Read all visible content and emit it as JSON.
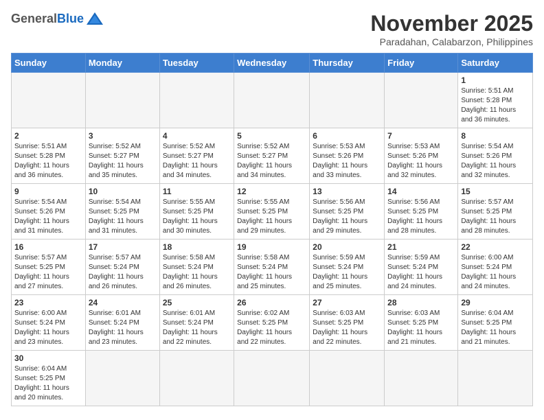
{
  "header": {
    "logo_general": "General",
    "logo_blue": "Blue",
    "month": "November 2025",
    "location": "Paradahan, Calabarzon, Philippines"
  },
  "days_of_week": [
    "Sunday",
    "Monday",
    "Tuesday",
    "Wednesday",
    "Thursday",
    "Friday",
    "Saturday"
  ],
  "weeks": [
    [
      {
        "day": "",
        "info": ""
      },
      {
        "day": "",
        "info": ""
      },
      {
        "day": "",
        "info": ""
      },
      {
        "day": "",
        "info": ""
      },
      {
        "day": "",
        "info": ""
      },
      {
        "day": "",
        "info": ""
      },
      {
        "day": "1",
        "info": "Sunrise: 5:51 AM\nSunset: 5:28 PM\nDaylight: 11 hours\nand 36 minutes."
      }
    ],
    [
      {
        "day": "2",
        "info": "Sunrise: 5:51 AM\nSunset: 5:28 PM\nDaylight: 11 hours\nand 36 minutes."
      },
      {
        "day": "3",
        "info": "Sunrise: 5:52 AM\nSunset: 5:27 PM\nDaylight: 11 hours\nand 35 minutes."
      },
      {
        "day": "4",
        "info": "Sunrise: 5:52 AM\nSunset: 5:27 PM\nDaylight: 11 hours\nand 34 minutes."
      },
      {
        "day": "5",
        "info": "Sunrise: 5:52 AM\nSunset: 5:27 PM\nDaylight: 11 hours\nand 34 minutes."
      },
      {
        "day": "6",
        "info": "Sunrise: 5:53 AM\nSunset: 5:26 PM\nDaylight: 11 hours\nand 33 minutes."
      },
      {
        "day": "7",
        "info": "Sunrise: 5:53 AM\nSunset: 5:26 PM\nDaylight: 11 hours\nand 32 minutes."
      },
      {
        "day": "8",
        "info": "Sunrise: 5:54 AM\nSunset: 5:26 PM\nDaylight: 11 hours\nand 32 minutes."
      }
    ],
    [
      {
        "day": "9",
        "info": "Sunrise: 5:54 AM\nSunset: 5:26 PM\nDaylight: 11 hours\nand 31 minutes."
      },
      {
        "day": "10",
        "info": "Sunrise: 5:54 AM\nSunset: 5:25 PM\nDaylight: 11 hours\nand 31 minutes."
      },
      {
        "day": "11",
        "info": "Sunrise: 5:55 AM\nSunset: 5:25 PM\nDaylight: 11 hours\nand 30 minutes."
      },
      {
        "day": "12",
        "info": "Sunrise: 5:55 AM\nSunset: 5:25 PM\nDaylight: 11 hours\nand 29 minutes."
      },
      {
        "day": "13",
        "info": "Sunrise: 5:56 AM\nSunset: 5:25 PM\nDaylight: 11 hours\nand 29 minutes."
      },
      {
        "day": "14",
        "info": "Sunrise: 5:56 AM\nSunset: 5:25 PM\nDaylight: 11 hours\nand 28 minutes."
      },
      {
        "day": "15",
        "info": "Sunrise: 5:57 AM\nSunset: 5:25 PM\nDaylight: 11 hours\nand 28 minutes."
      }
    ],
    [
      {
        "day": "16",
        "info": "Sunrise: 5:57 AM\nSunset: 5:25 PM\nDaylight: 11 hours\nand 27 minutes."
      },
      {
        "day": "17",
        "info": "Sunrise: 5:57 AM\nSunset: 5:24 PM\nDaylight: 11 hours\nand 26 minutes."
      },
      {
        "day": "18",
        "info": "Sunrise: 5:58 AM\nSunset: 5:24 PM\nDaylight: 11 hours\nand 26 minutes."
      },
      {
        "day": "19",
        "info": "Sunrise: 5:58 AM\nSunset: 5:24 PM\nDaylight: 11 hours\nand 25 minutes."
      },
      {
        "day": "20",
        "info": "Sunrise: 5:59 AM\nSunset: 5:24 PM\nDaylight: 11 hours\nand 25 minutes."
      },
      {
        "day": "21",
        "info": "Sunrise: 5:59 AM\nSunset: 5:24 PM\nDaylight: 11 hours\nand 24 minutes."
      },
      {
        "day": "22",
        "info": "Sunrise: 6:00 AM\nSunset: 5:24 PM\nDaylight: 11 hours\nand 24 minutes."
      }
    ],
    [
      {
        "day": "23",
        "info": "Sunrise: 6:00 AM\nSunset: 5:24 PM\nDaylight: 11 hours\nand 23 minutes."
      },
      {
        "day": "24",
        "info": "Sunrise: 6:01 AM\nSunset: 5:24 PM\nDaylight: 11 hours\nand 23 minutes."
      },
      {
        "day": "25",
        "info": "Sunrise: 6:01 AM\nSunset: 5:24 PM\nDaylight: 11 hours\nand 22 minutes."
      },
      {
        "day": "26",
        "info": "Sunrise: 6:02 AM\nSunset: 5:25 PM\nDaylight: 11 hours\nand 22 minutes."
      },
      {
        "day": "27",
        "info": "Sunrise: 6:03 AM\nSunset: 5:25 PM\nDaylight: 11 hours\nand 22 minutes."
      },
      {
        "day": "28",
        "info": "Sunrise: 6:03 AM\nSunset: 5:25 PM\nDaylight: 11 hours\nand 21 minutes."
      },
      {
        "day": "29",
        "info": "Sunrise: 6:04 AM\nSunset: 5:25 PM\nDaylight: 11 hours\nand 21 minutes."
      }
    ],
    [
      {
        "day": "30",
        "info": "Sunrise: 6:04 AM\nSunset: 5:25 PM\nDaylight: 11 hours\nand 20 minutes."
      },
      {
        "day": "",
        "info": ""
      },
      {
        "day": "",
        "info": ""
      },
      {
        "day": "",
        "info": ""
      },
      {
        "day": "",
        "info": ""
      },
      {
        "day": "",
        "info": ""
      },
      {
        "day": "",
        "info": ""
      }
    ]
  ]
}
